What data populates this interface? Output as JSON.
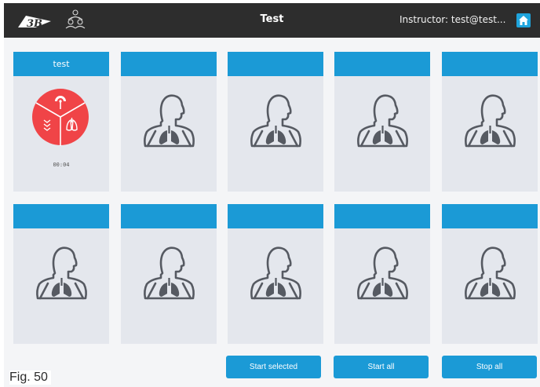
{
  "header": {
    "title": "Test",
    "instructor": "Instructor: test@test....",
    "logo_text": "3B",
    "icons": {
      "logo": "3b-logo-icon",
      "users": "users-icon",
      "home": "home-icon"
    },
    "home_color": "#1fa4dc",
    "bar_color": "#2d2d2d"
  },
  "cards": [
    {
      "label": "test",
      "active": true,
      "timer": "00:04",
      "status_color": "#f04447"
    },
    {
      "label": "",
      "active": false
    },
    {
      "label": "",
      "active": false
    },
    {
      "label": "",
      "active": false
    },
    {
      "label": "",
      "active": false
    },
    {
      "label": "",
      "active": false
    },
    {
      "label": "",
      "active": false
    },
    {
      "label": "",
      "active": false
    },
    {
      "label": "",
      "active": false
    },
    {
      "label": "",
      "active": false
    }
  ],
  "card_icon": "mannequin-lungs-icon",
  "accent_color": "#1b9ad6",
  "buttons": {
    "start_selected": "Start selected",
    "start_all": "Start all",
    "stop_all": "Stop all"
  },
  "caption": "Fig. 50"
}
